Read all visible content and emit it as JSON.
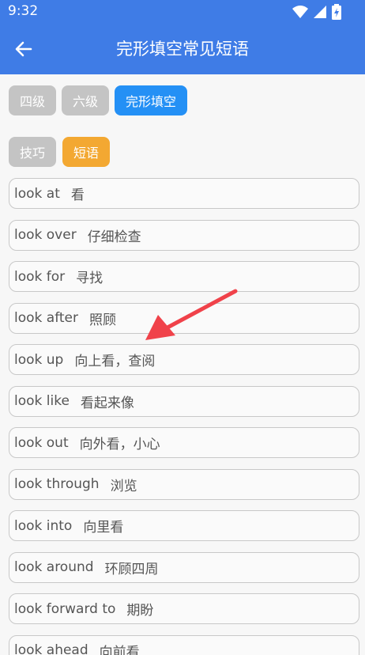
{
  "status": {
    "time": "9:32",
    "icons": [
      "wifi-icon",
      "signal-icon",
      "battery-icon"
    ]
  },
  "header": {
    "title": "完形填空常见短语",
    "back_icon": "arrow-left-icon"
  },
  "tabs_level": [
    {
      "label": "四级",
      "active": false
    },
    {
      "label": "六级",
      "active": false
    },
    {
      "label": "完形填空",
      "active": true
    }
  ],
  "tabs_type": [
    {
      "label": "技巧",
      "active": false
    },
    {
      "label": "短语",
      "active": true
    }
  ],
  "phrases": [
    {
      "en": "look at",
      "zh": "看"
    },
    {
      "en": "look over",
      "zh": "仔细检查"
    },
    {
      "en": "look for",
      "zh": "寻找"
    },
    {
      "en": "look after",
      "zh": "照顾"
    },
    {
      "en": "look up",
      "zh": "向上看，查阅"
    },
    {
      "en": "look like",
      "zh": "看起来像"
    },
    {
      "en": "look out",
      "zh": "向外看，小心"
    },
    {
      "en": "look through",
      "zh": "浏览"
    },
    {
      "en": "look into",
      "zh": "向里看"
    },
    {
      "en": "look around",
      "zh": "环顾四周"
    },
    {
      "en": "look forward to",
      "zh": "期盼"
    },
    {
      "en": "look ahead",
      "zh": "向前看"
    }
  ],
  "colors": {
    "primary": "#3f7ce6",
    "active_tab": "#2490f5",
    "active_type": "#f3a832",
    "inactive": "#c4c4c4",
    "annotation_arrow": "#f0424a"
  }
}
